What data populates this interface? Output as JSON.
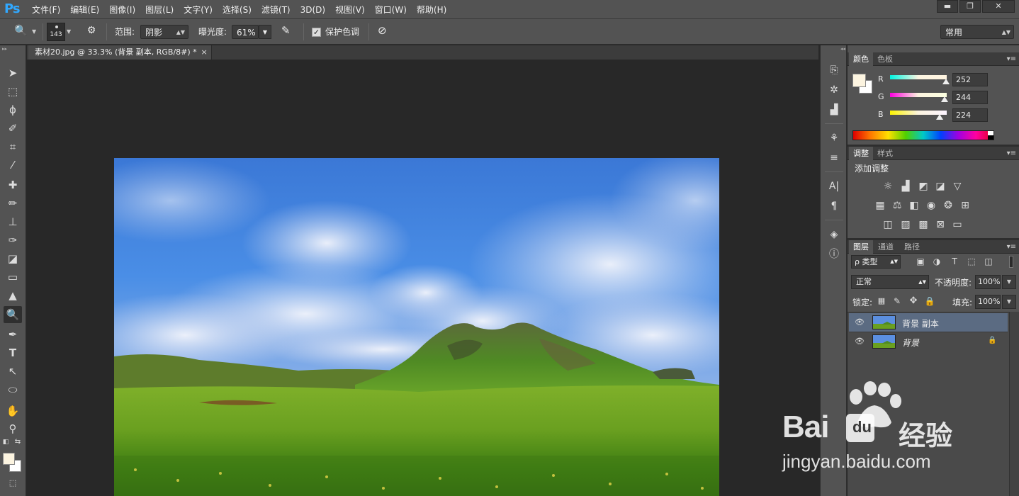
{
  "app": {
    "logo": "Ps"
  },
  "menu": [
    "文件(F)",
    "编辑(E)",
    "图像(I)",
    "图层(L)",
    "文字(Y)",
    "选择(S)",
    "滤镜(T)",
    "3D(D)",
    "视图(V)",
    "窗口(W)",
    "帮助(H)"
  ],
  "window_controls": {
    "minimize": "▬",
    "restore": "❐",
    "close": "✕"
  },
  "options": {
    "brush_size": "143",
    "range_label": "范围:",
    "range_value": "阴影",
    "exposure_label": "曝光度:",
    "exposure_value": "61%",
    "protect_tones_label": "保护色调",
    "protect_tones_checked": true,
    "workspace": "常用"
  },
  "document": {
    "tab_title": "素材20.jpg @ 33.3% (背景 副本, RGB/8#) *",
    "tab_close": "×"
  },
  "color_panel": {
    "tabs": [
      "颜色",
      "色板"
    ],
    "r_label": "R",
    "g_label": "G",
    "b_label": "B",
    "r": "252",
    "g": "244",
    "b": "224",
    "fg_color": "#fcf4e0",
    "bg_color": "#ffffff"
  },
  "adjustments_panel": {
    "tabs": [
      "调整",
      "样式"
    ],
    "heading": "添加调整"
  },
  "layers_panel": {
    "tabs": [
      "图层",
      "通道",
      "路径"
    ],
    "filter_kind": "ρ 类型",
    "blend_mode": "正常",
    "opacity_label": "不透明度:",
    "opacity": "100%",
    "lock_label": "锁定:",
    "fill_label": "填充:",
    "fill": "100%",
    "layers": [
      {
        "name": "背景 副本",
        "selected": true
      },
      {
        "name": "背景",
        "selected": false,
        "locked": true
      }
    ]
  },
  "watermark": {
    "brand": "Bai",
    "brand_cn": "经验",
    "url": "jingyan.baidu.com"
  },
  "colors": {
    "menu_bg": "#535353",
    "canvas_bg": "#282828",
    "selected_layer": "#5b6b82"
  }
}
